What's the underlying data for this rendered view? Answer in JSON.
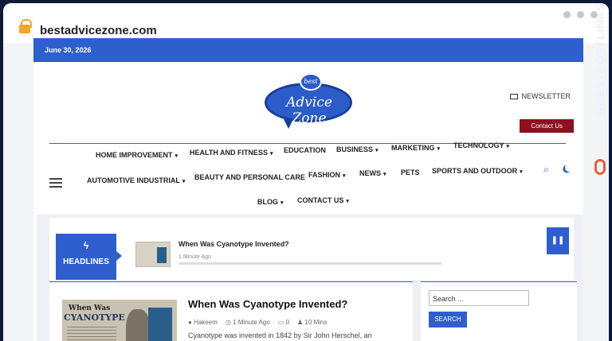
{
  "browser": {
    "url": "bestadvicezone.com"
  },
  "topbar": {
    "date": "June 30, 2026"
  },
  "logo": {
    "best": "best",
    "name": "Advice Zone"
  },
  "header": {
    "newsletter": "NEWSLETTER",
    "contact": "Contact Us"
  },
  "nav": {
    "row1": [
      "HOME IMPROVEMENT",
      "HEALTH AND FITNESS",
      "EDUCATION",
      "BUSINESS",
      "MARKETING",
      "TECHNOLOGY"
    ],
    "row2": [
      "AUTOMOTIVE INDUSTRIAL",
      "BEAUTY AND PERSONAL CARE",
      "FASHION",
      "NEWS",
      "PETS",
      "SPORTS AND OUTDOOR"
    ],
    "row3": [
      "BLOG",
      "CONTACT US"
    ]
  },
  "ticker": {
    "label": "HEADLINES",
    "title": "When Was Cyanotype Invented?",
    "time": "1 Minute Ago"
  },
  "post": {
    "thumb_l1": "When Was",
    "thumb_l2": "CYANOTYPE",
    "title": "When Was Cyanotype Invented?",
    "author": "Hakeem",
    "time": "1 Minute Ago",
    "comments": "0",
    "read": "10 Mins",
    "excerpt": "Cyanotype was invented in 1842 by Sir John Herschel, an"
  },
  "sidebar": {
    "placeholder": "Search ...",
    "button": "SEARCH"
  },
  "brand": {
    "text": "GUESTPOSTLINKS"
  }
}
